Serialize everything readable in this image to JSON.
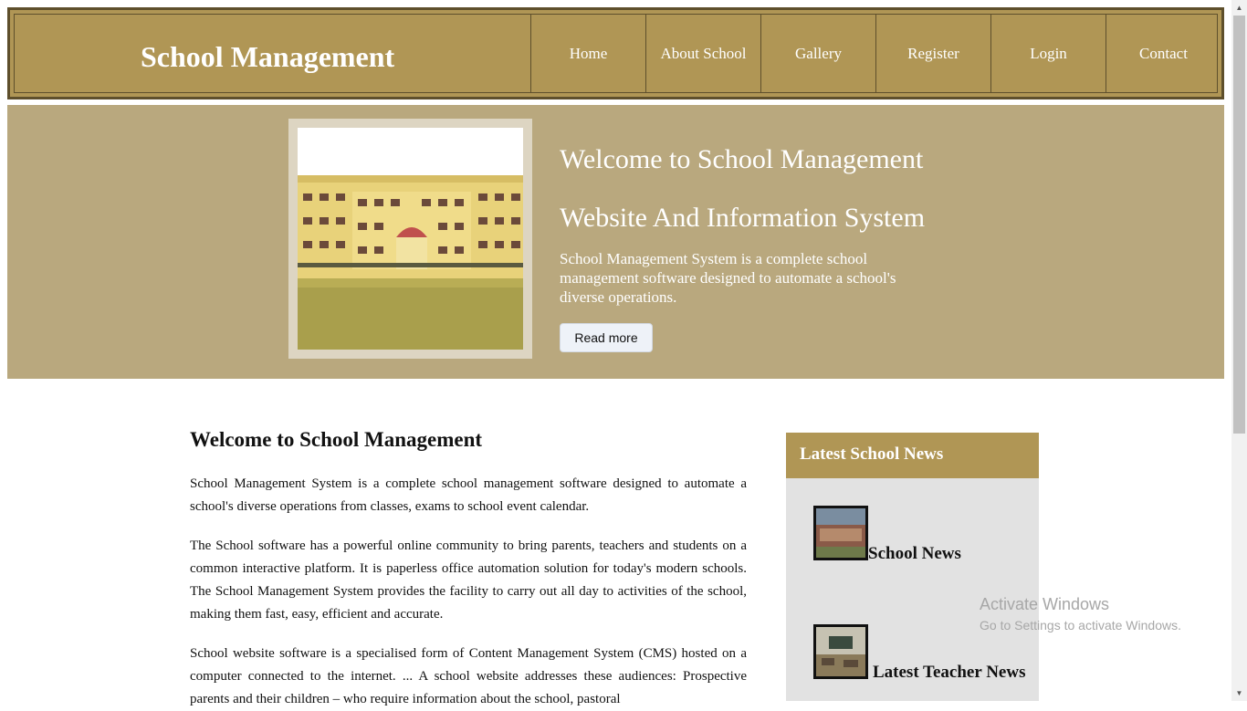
{
  "header": {
    "title": "School Management",
    "nav": [
      "Home",
      "About School",
      "Gallery",
      "Register",
      "Login",
      "Contact"
    ]
  },
  "hero": {
    "title_line1": "Welcome to School Management",
    "title_line2": "Website And Information System",
    "text": "School Management System is a complete school management software designed to automate a school's diverse operations.",
    "button": "Read more"
  },
  "main": {
    "heading": "Welcome to School Management",
    "paragraphs": [
      "School Management System is a complete school management software designed to automate a school's diverse operations from classes, exams to school event calendar.",
      "The School software has a powerful online community to bring parents, teachers and students on a common interactive platform. It is paperless office automation solution for today's modern schools. The School Management System provides the facility to carry out all day to activities of the school, making them fast, easy, efficient and accurate.",
      "School website software is a specialised form of Content Management System (CMS) hosted on a computer connected to the internet. ... A school website addresses these audiences: Prospective parents and their children – who require information about the school, pastoral"
    ]
  },
  "sidebar": {
    "title": "Latest School News",
    "items": [
      {
        "label": "School News"
      },
      {
        "label": "Latest Teacher News"
      }
    ]
  },
  "watermark": {
    "title": "Activate Windows",
    "subtitle": "Go to Settings to activate Windows."
  },
  "colors": {
    "header_bg": "#b09655",
    "hero_bg": "#b9a87e",
    "sidebar_bg": "#e2e2e2"
  }
}
